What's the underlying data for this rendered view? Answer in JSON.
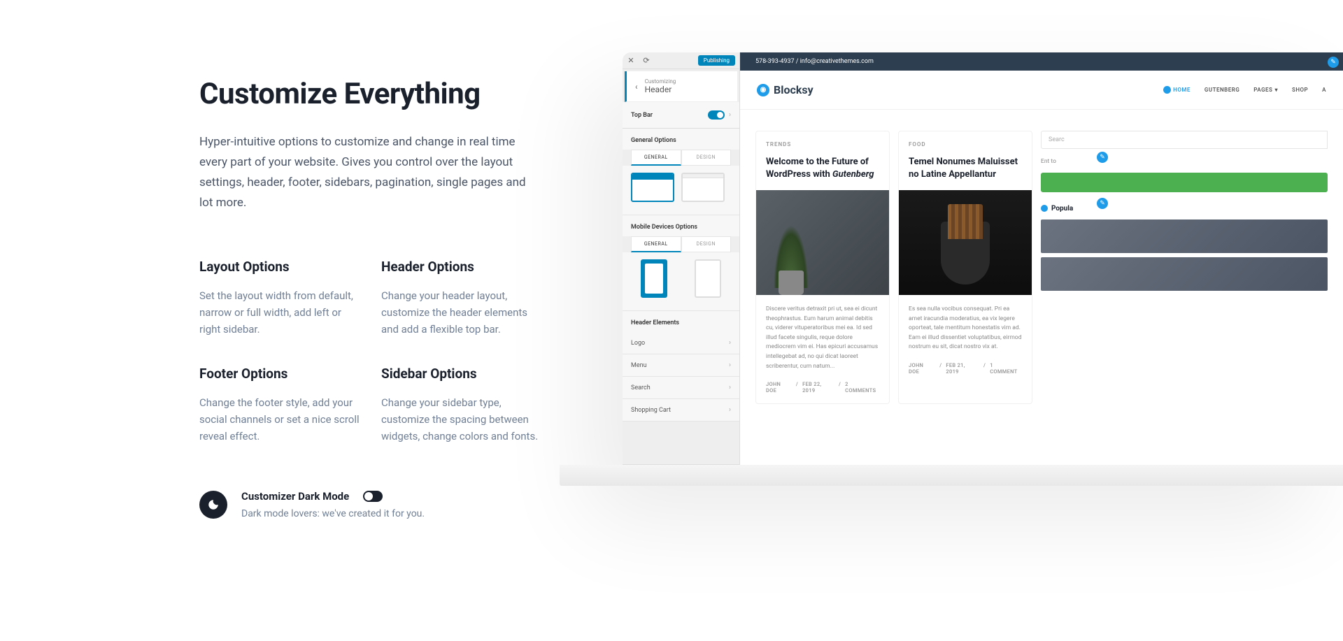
{
  "main": {
    "heading": "Customize Everything",
    "subtitle": "Hyper-intuitive options to customize and change in real time every part of your website. Gives you control over the layout settings, header, footer, sidebars, pagination, single pages and lot more."
  },
  "features": [
    {
      "title": "Layout Options",
      "desc": "Set the layout width from default, narrow or full width, add left or right sidebar."
    },
    {
      "title": "Header Options",
      "desc": "Change your header layout, customize the header elements and add a flexible top bar."
    },
    {
      "title": "Footer Options",
      "desc": "Change the footer style, add your social channels or set a nice scroll reveal effect."
    },
    {
      "title": "Sidebar Options",
      "desc": "Change your sidebar type, customize the spacing between widgets, change colors and fonts."
    }
  ],
  "darkMode": {
    "title": "Customizer Dark Mode",
    "desc": "Dark mode lovers: we've created it for you."
  },
  "customizer": {
    "publish": "Publishing",
    "customizing": "Customizing",
    "section": "Header",
    "topBar": "Top Bar",
    "generalOptions": "General Options",
    "tabGeneral": "GENERAL",
    "tabDesign": "DESIGN",
    "mobileOptions": "Mobile Devices Options",
    "headerElements": "Header Elements",
    "items": [
      "Logo",
      "Menu",
      "Search",
      "Shopping Cart"
    ]
  },
  "preview": {
    "topbar": "578-393-4937 / info@creativethemes.com",
    "brand": "Blocksy",
    "menu": [
      "HOME",
      "GUTENBERG",
      "PAGES",
      "SHOP",
      "A"
    ],
    "posts": [
      {
        "category": "TRENDS",
        "title": "Welcome to the Future of WordPress with Gutenberg",
        "excerpt": "Discere veritus detraxit pri ut, sea ei dicunt theophrastus. Eum harum animal debitis cu, viderer vituperatoribus mei ea. Id sed illud facete singulis, reque dolore mediocrem vim ei. Has epicuri accusamus intellegebat ad, no qui dicat laoreet scriberentur, cum natum...",
        "author": "JOHN DOE",
        "date": "FEB 22, 2019",
        "comments": "2 COMMENTS"
      },
      {
        "category": "FOOD",
        "title": "Temel Nonumes Maluisset no Latine Appellantur",
        "excerpt": "Es sea nulla vocibus consequat. Pri ea amet iracundia moderatius, ea vix legere oporteat, tale mentitum honestatis vim ad. Eam ei illud dissentiet voluptatibus, eirmod nostrum eu sit, dicat nostro vix at.",
        "author": "JOHN DOE",
        "date": "FEB 21, 2019",
        "comments": "1 COMMENT"
      }
    ],
    "searchPlaceholder": "Searc",
    "sidebarText": "Ent to",
    "popularHeading": "Popula"
  }
}
